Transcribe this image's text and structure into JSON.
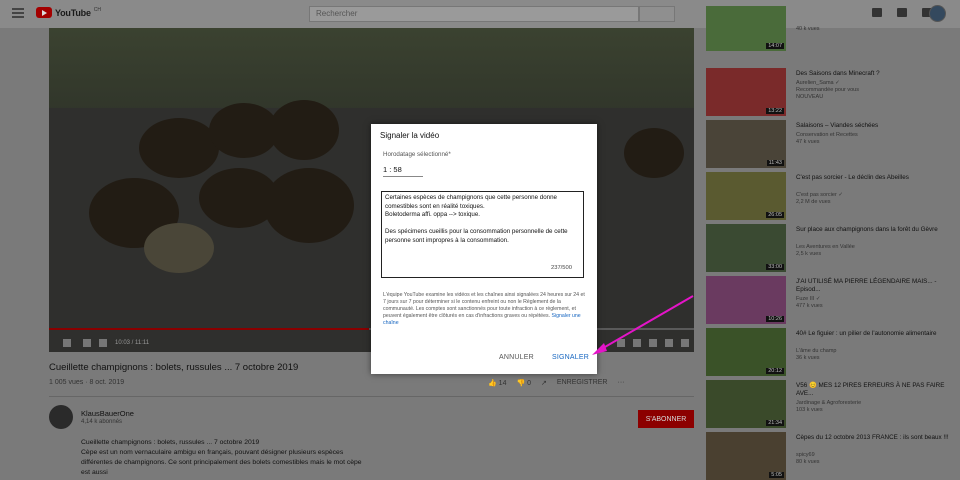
{
  "header": {
    "logo_text": "YouTube",
    "logo_region": "CH",
    "search_placeholder": "Rechercher"
  },
  "player": {
    "time": "10:03 / 11:11"
  },
  "video": {
    "title": "Cueillette champignons : bolets, russules ... 7 octobre 2019",
    "views": "1 005 vues · 8 oct. 2019",
    "likes": "14",
    "dislikes": "0",
    "save_label": "ENREGISTRER"
  },
  "channel": {
    "name": "KlausBauerOne",
    "subscribers": "4,14 k abonnés",
    "subscribe_label": "S'ABONNER",
    "description": "Cueillette champignons : bolets, russules ... 7 octobre 2019\nCèpe est un nom vernaculaire ambigu en français, pouvant désigner plusieurs espèces différentes de champignons. Ce sont principalement des bolets comestibles mais le mot cèpe est aussi"
  },
  "sidebar": [
    {
      "title": "",
      "meta": "40 k vues",
      "duration": "14:07",
      "color": "#4a6b3a"
    },
    {
      "title": "Des Saisons dans Minecraft ?",
      "meta": "Aurelien_Sama ✓\nRecommandée pour vous\nNOUVEAU",
      "duration": "13:22",
      "color": "#7a2a2a"
    },
    {
      "title": "Salaisons – Viandes séchées",
      "meta": "Conservation et Recettes\n47 k vues",
      "duration": "11:43",
      "color": "#4a4438"
    },
    {
      "title": "C'est pas sorcier - Le déclin des Abeilles",
      "meta": "C'est pas sorcier ✓\n2,2 M de vues",
      "duration": "26:05",
      "color": "#5a5a30"
    },
    {
      "title": "Sur place aux champignons dans la forêt du Gèvre",
      "meta": "Les Aventures en Vallée\n2,5 k vues",
      "duration": "33:00",
      "color": "#3a4a32"
    },
    {
      "title": "J'AI UTILISÉ MA PIERRE LÉGENDAIRE MAIS... - Episod...",
      "meta": "Fuze III ✓\n477 k vues",
      "duration": "10:26",
      "color": "#6a3a60"
    },
    {
      "title": "40# Le figuier : un pilier de l'autonomie alimentaire",
      "meta": "L'âme du champ\n36 k vues",
      "duration": "20:12",
      "color": "#3a5228"
    },
    {
      "title": "V56 😊 MES 12 PIRES ERREURS À NE PAS FAIRE AVE...",
      "meta": "Jardinage & Agroforesterie\n103 k vues",
      "duration": "21:34",
      "color": "#3a4a2a"
    },
    {
      "title": "Cèpes du 12 octobre 2013 FRANCE : ils sont beaux !!!",
      "meta": "spicy69\n80 k vues",
      "duration": "5:05",
      "color": "#4a4030"
    }
  ],
  "report_dialog": {
    "title": "Signaler la vidéo",
    "timestamp_label": "Horodatage sélectionné*",
    "timestamp_value": "1 : 58",
    "text": "Certaines espèces de champignons que cette personne donne comestibles sont en réalité toxiques.\nBoletoderma affi. oppa --> toxique.\n\nDes spécimens cueillis pour la consommation personnelle de cette personne sont impropres à la consommation.",
    "counter": "237/500",
    "notice": "L'équipe YouTube examine les vidéos et les chaînes ainsi signalées 24 heures sur 24 et 7 jours sur 7 pour déterminer si le contenu enfreint ou non le Règlement de la communauté. Les comptes sont sanctionnés pour toute infraction à ce règlement, et peuvent également être clôturés en cas d'infractions graves ou répétées.",
    "notice_link": "Signaler une chaîne",
    "cancel_label": "ANNULER",
    "report_label": "SIGNALER"
  },
  "colors": {
    "accent_blue": "#1565c0",
    "annotation_arrow": "#e414c8",
    "subscribe_red": "#8c0000"
  }
}
